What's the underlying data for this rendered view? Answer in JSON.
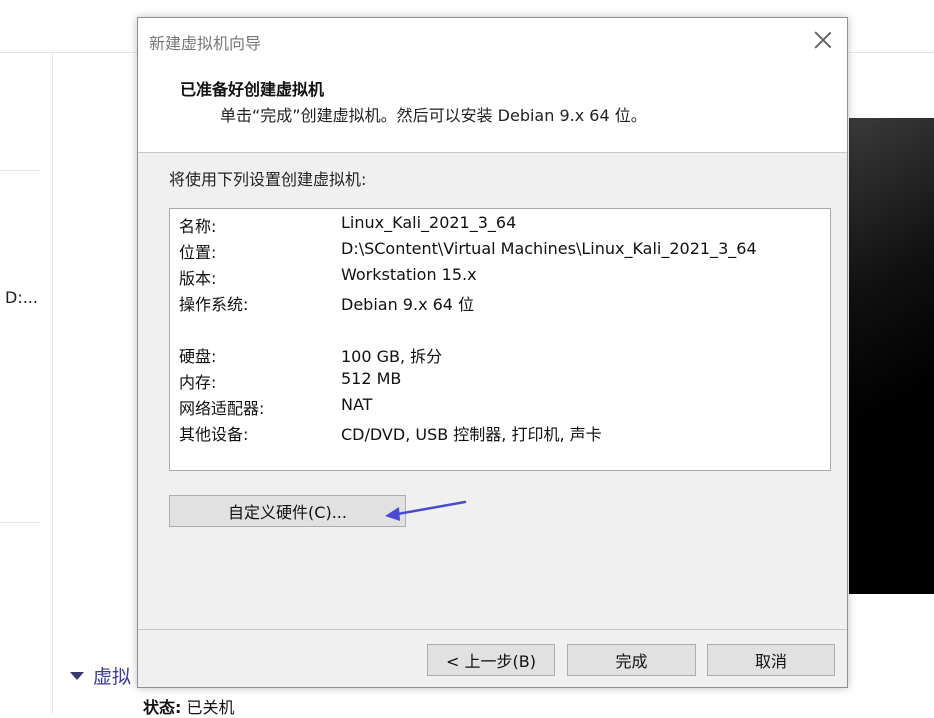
{
  "background": {
    "path_text": "D:...",
    "section_label": "虚拟",
    "status_label": "状态:",
    "status_value": "已关机"
  },
  "dialog": {
    "title": "新建虚拟机向导",
    "header_title": "已准备好创建虚拟机",
    "header_subtitle": "单击“完成”创建虚拟机。然后可以安装 Debian 9.x 64 位。",
    "intro": "将使用下列设置创建虚拟机:",
    "summary": [
      {
        "label": "名称:",
        "value": "Linux_Kali_2021_3_64"
      },
      {
        "label": "位置:",
        "value": "D:\\SContent\\Virtual Machines\\Linux_Kali_2021_3_64"
      },
      {
        "label": "版本:",
        "value": "Workstation 15.x"
      },
      {
        "label": "操作系统:",
        "value": "Debian 9.x 64 位"
      },
      {
        "label": "硬盘:",
        "value": "100 GB, 拆分"
      },
      {
        "label": "内存:",
        "value": "512 MB"
      },
      {
        "label": "网络适配器:",
        "value": "NAT"
      },
      {
        "label": "其他设备:",
        "value": "CD/DVD, USB 控制器, 打印机, 声卡"
      }
    ],
    "buttons": {
      "customize": "自定义硬件(C)...",
      "back": "< 上一步(B)",
      "finish": "完成",
      "cancel": "取消"
    }
  },
  "colors": {
    "annotation_arrow": "#4a4ad0"
  }
}
